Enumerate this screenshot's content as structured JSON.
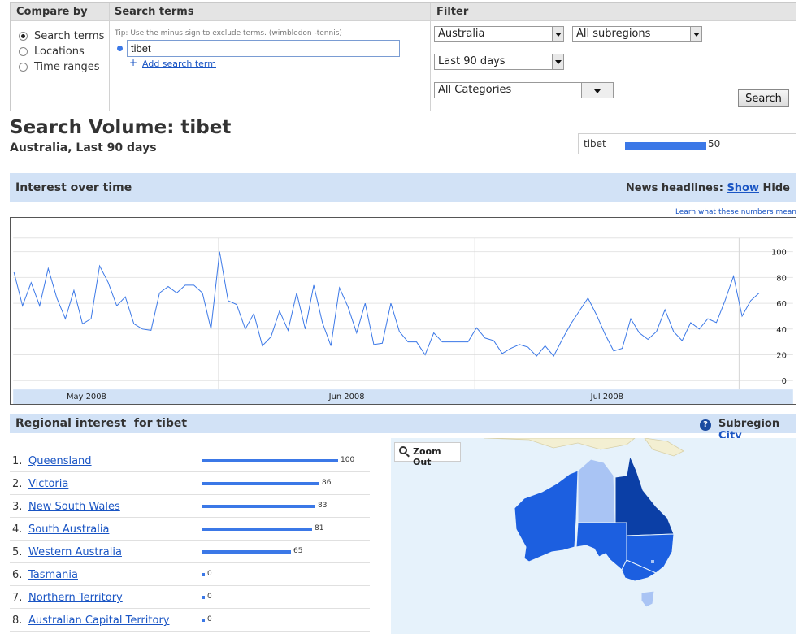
{
  "compare": {
    "header": "Compare by",
    "options": [
      {
        "label": "Search terms",
        "selected": true
      },
      {
        "label": "Locations",
        "selected": false
      },
      {
        "label": "Time ranges",
        "selected": false
      }
    ]
  },
  "terms": {
    "header": "Search terms",
    "tip": "Tip: Use the minus sign to exclude terms. (wimbledon -tennis)",
    "term_value": "tibet",
    "add_label": "Add search term"
  },
  "filter": {
    "header": "Filter",
    "country": "Australia",
    "subregion": "All subregions",
    "range": "Last 90 days",
    "category": "All Categories",
    "search_label": "Search"
  },
  "result": {
    "title": "Search Volume: tibet",
    "subtitle": "Australia, Last 90 days",
    "term": "tibet",
    "term_value": "50",
    "term_fraction": 0.5
  },
  "interest": {
    "title": "Interest over time",
    "news_label": "News headlines:",
    "show_label": "Show",
    "hide_label": "Hide",
    "learn_label": "Learn what these numbers mean"
  },
  "chart_data": {
    "type": "line",
    "ylim": [
      0,
      100
    ],
    "yticks": [
      0,
      20,
      40,
      60,
      80,
      100
    ],
    "xlabels": [
      "May 2008",
      "Jun 2008",
      "Jul 2008"
    ],
    "series": [
      {
        "values": [
          84,
          58,
          76,
          58,
          87,
          64,
          48,
          70,
          44,
          48,
          89,
          76,
          58,
          65,
          44,
          40,
          39,
          68,
          73,
          68,
          74,
          74,
          68,
          40,
          100,
          62,
          59,
          40,
          52,
          27,
          34,
          54,
          39,
          68,
          40,
          74,
          45,
          27,
          72,
          57,
          37,
          60,
          28,
          29,
          60,
          38,
          30,
          30,
          20,
          37,
          30,
          30,
          30,
          30,
          41,
          33,
          31,
          21,
          25,
          28,
          26,
          19,
          27,
          19,
          32,
          44,
          54,
          64,
          51,
          36,
          23,
          25,
          48,
          37,
          32,
          38,
          55,
          38,
          31,
          45,
          40,
          48,
          45,
          62,
          81,
          50,
          62,
          68
        ]
      }
    ]
  },
  "region": {
    "title": "Regional interest  for tibet",
    "subregion_label": "Subregion",
    "city_label": "City",
    "zoom_label": "Zoom Out",
    "items": [
      {
        "rank": "1.",
        "name": "Queensland",
        "value": "100",
        "fraction": 1.0
      },
      {
        "rank": "2.",
        "name": "Victoria",
        "value": "86",
        "fraction": 0.86
      },
      {
        "rank": "3.",
        "name": "New South Wales",
        "value": "83",
        "fraction": 0.83
      },
      {
        "rank": "4.",
        "name": "South Australia",
        "value": "81",
        "fraction": 0.81
      },
      {
        "rank": "5.",
        "name": "Western Australia",
        "value": "65",
        "fraction": 0.65
      },
      {
        "rank": "6.",
        "name": "Tasmania",
        "value": "0",
        "fraction": 0
      },
      {
        "rank": "7.",
        "name": "Northern Territory",
        "value": "0",
        "fraction": 0
      },
      {
        "rank": "8.",
        "name": "Australian Capital Territory",
        "value": "0",
        "fraction": 0
      }
    ]
  },
  "colors": {
    "accent": "#3b78e7",
    "section_bar": "#d2e2f6",
    "link": "#1a55c4",
    "map_dark": "#0b3fa6",
    "map_mid": "#1c5fe0",
    "map_light": "#a9c4f4"
  }
}
